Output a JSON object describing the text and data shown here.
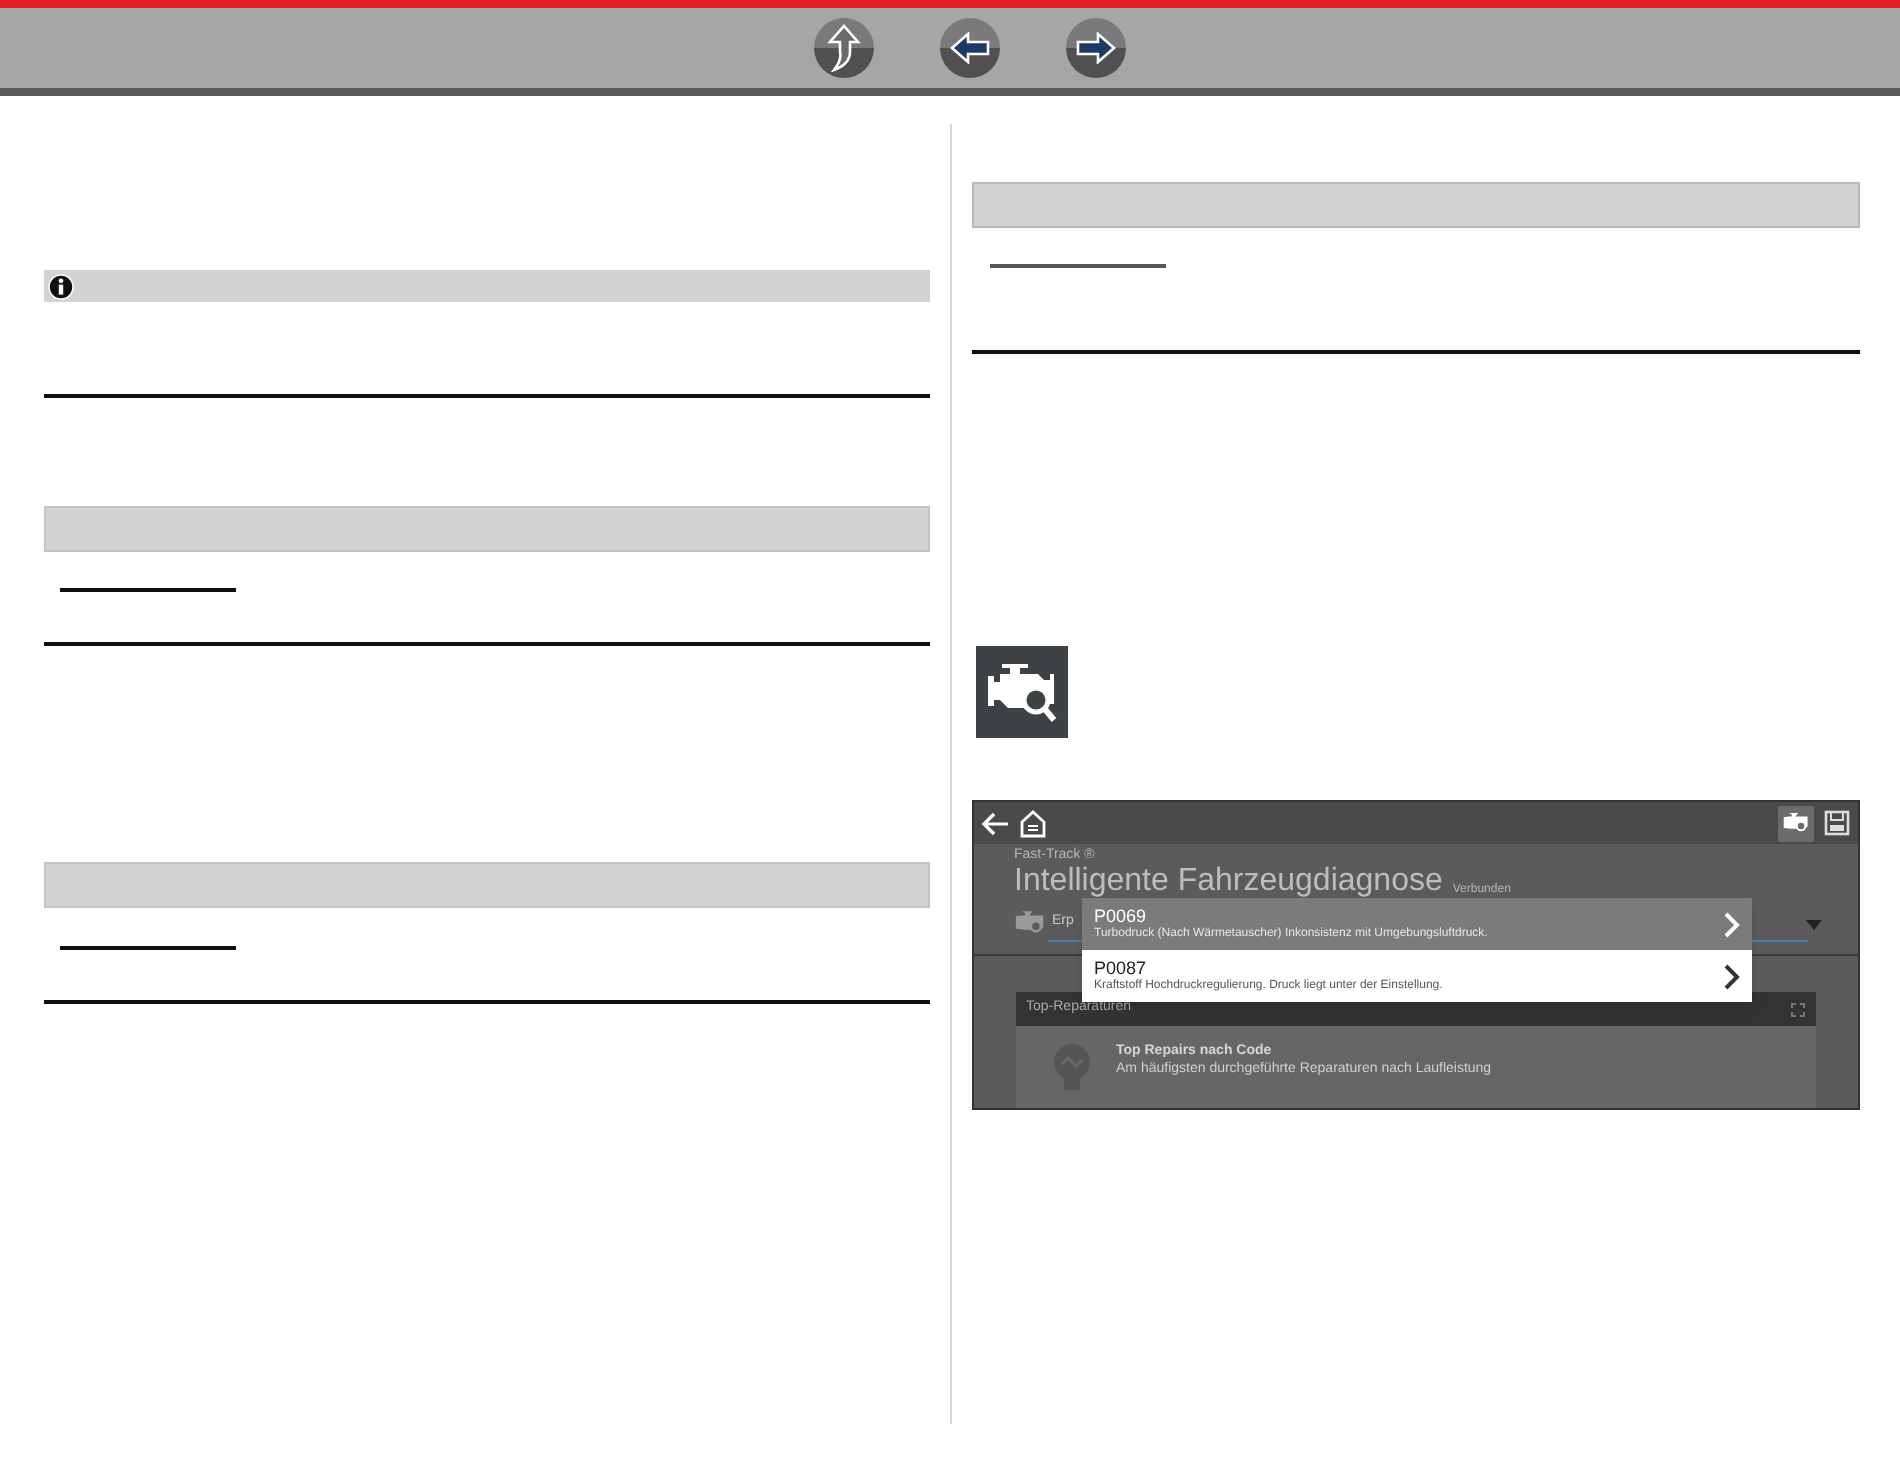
{
  "screenshot": {
    "brand": "Fast-Track ®",
    "title": "Intelligente Fahrzeugdiagnose",
    "status": "Verbunden",
    "field_text": "Erp",
    "codes": [
      {
        "code": "P0069",
        "description": "Turbodruck (Nach Wärmetauscher) Inkonsistenz mit Umgebungsluftdruck.",
        "selected": true
      },
      {
        "code": "P0087",
        "description": "Kraftstoff Hochdruckregulierung. Druck liegt unter der Einstellung.",
        "selected": false
      }
    ],
    "card": {
      "title": "Top-Reparaturen",
      "item_title": "Top Repairs nach Code",
      "item_subtitle": "Am häufigsten durchgeführte Reparaturen nach Laufleistung"
    }
  }
}
